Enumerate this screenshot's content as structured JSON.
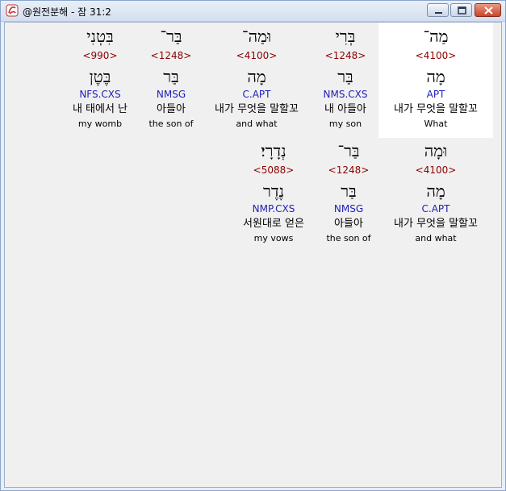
{
  "window": {
    "title": "@원전분해 - 잠 31:2",
    "app_icon": "swirl-app-icon",
    "controls": {
      "minimize": "minimize-icon",
      "maximize": "maximize-icon",
      "close": "close-icon"
    }
  },
  "rows": [
    {
      "words": [
        {
          "hebrew": "מַה־",
          "strong": "<4100>",
          "lemma": "מָה",
          "morph": "APT",
          "korean": "내가 무엇을 말할꼬",
          "english": "What",
          "selected": true
        },
        {
          "hebrew": "בְּרִי",
          "strong": "<1248>",
          "lemma": "בַּר",
          "morph": "NMS.CXS",
          "korean": "내 아들아",
          "english": "my son",
          "selected": false
        },
        {
          "hebrew": "וּמַה־",
          "strong": "<4100>",
          "lemma": "מָה",
          "morph": "C.APT",
          "korean": "내가 무엇을 말할꼬",
          "english": "and what",
          "selected": false
        },
        {
          "hebrew": "בַּר־",
          "strong": "<1248>",
          "lemma": "בַּר",
          "morph": "NMSG",
          "korean": "아들아",
          "english": "the son of",
          "selected": false
        },
        {
          "hebrew": "בִּטְנִי",
          "strong": "<990>",
          "lemma": "בֶּטֶן",
          "morph": "NFS.CXS",
          "korean": "내 태에서 난",
          "english": "my womb",
          "selected": false
        }
      ]
    },
    {
      "words": [
        {
          "hebrew": "וּמָה",
          "strong": "<4100>",
          "lemma": "מָה",
          "morph": "C.APT",
          "korean": "내가 무엇을 말할꼬",
          "english": "and what",
          "selected": false
        },
        {
          "hebrew": "בַּר־",
          "strong": "<1248>",
          "lemma": "בַּר",
          "morph": "NMSG",
          "korean": "아들아",
          "english": "the son of",
          "selected": false
        },
        {
          "hebrew": "נְדָרָי׃",
          "strong": "<5088>",
          "lemma": "נֶדֶר",
          "morph": "NMP.CXS",
          "korean": "서원대로 얻은",
          "english": "my vows",
          "selected": false
        }
      ]
    }
  ]
}
